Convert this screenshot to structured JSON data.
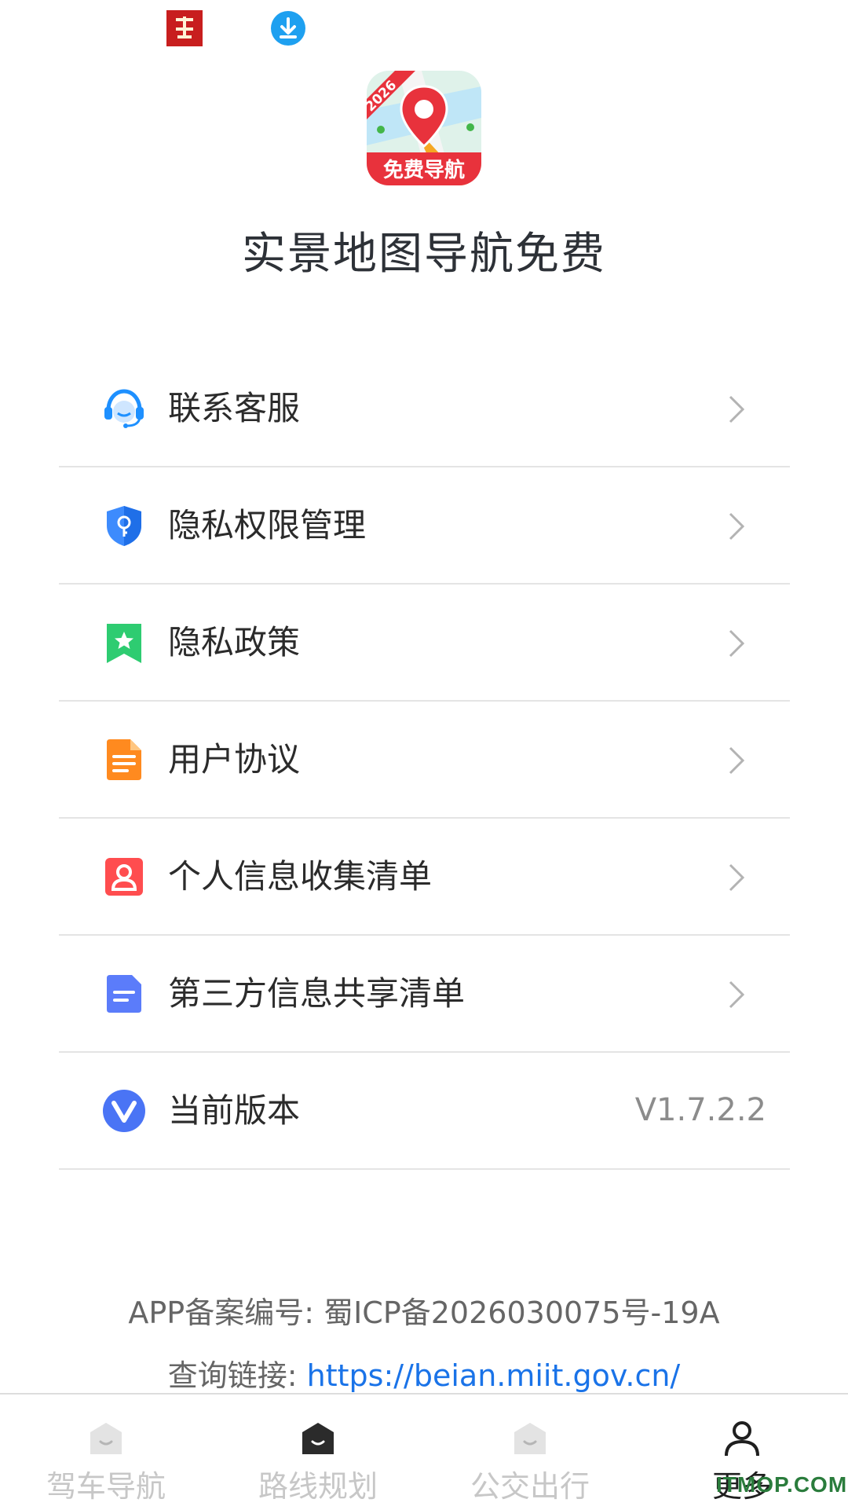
{
  "status_bar": {
    "icons": [
      "app-notification-icon",
      "download-icon"
    ]
  },
  "app": {
    "logo_badge_year": "2026",
    "logo_ribbon_text": "免费导航",
    "name": "实景地图导航免费"
  },
  "menu": {
    "items": [
      {
        "label": "联系客服",
        "icon": "headset-icon"
      },
      {
        "label": "隐私权限管理",
        "icon": "shield-key-icon"
      },
      {
        "label": "隐私政策",
        "icon": "bookmark-star-icon"
      },
      {
        "label": "用户协议",
        "icon": "document-icon"
      },
      {
        "label": "个人信息收集清单",
        "icon": "person-card-icon"
      },
      {
        "label": "第三方信息共享清单",
        "icon": "file-share-icon"
      },
      {
        "label": "当前版本",
        "icon": "version-v-icon",
        "value": "V1.7.2.2"
      }
    ]
  },
  "footer": {
    "icp_record": "APP备案编号: 蜀ICP备2026030075号-19A",
    "link_prefix": "查询链接: ",
    "link_url": "https://beian.miit.gov.cn/"
  },
  "tabbar": {
    "tabs": [
      {
        "label": "驾车导航",
        "active": false
      },
      {
        "label": "路线规划",
        "active": false
      },
      {
        "label": "公交出行",
        "active": false
      },
      {
        "label": "更多",
        "active": true
      }
    ]
  },
  "watermark": "ITMOP.COM",
  "colors": {
    "accent_link": "#1a73e8",
    "tab_inactive": "#c7c7c7",
    "tab_active": "#1f1f1f",
    "logo_red": "#e8323c"
  }
}
